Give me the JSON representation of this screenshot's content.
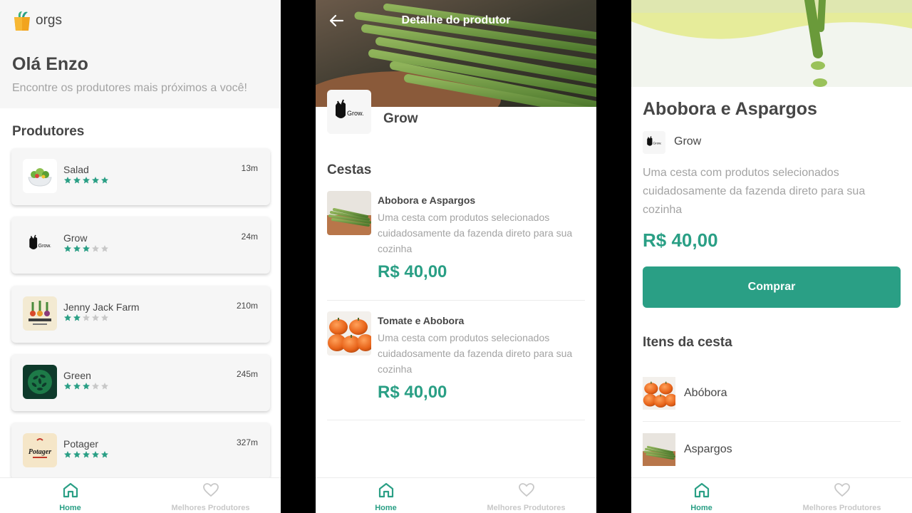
{
  "colors": {
    "accent": "#2a9f85",
    "text": "#464646",
    "muted": "#a3a3a3",
    "star_off": "#c8c8c8"
  },
  "home": {
    "app_name": "orgs",
    "greeting": "Olá Enzo",
    "subtitle": "Encontre os produtores mais próximos a você!",
    "section_title": "Produtores",
    "producers": [
      {
        "name": "Salad",
        "distance": "13m",
        "rating": 5,
        "logo": "salad-bowl-icon"
      },
      {
        "name": "Grow",
        "distance": "24m",
        "rating": 3,
        "logo": "grow-logo"
      },
      {
        "name": "Jenny Jack Farm",
        "distance": "210m",
        "rating": 2,
        "logo": "jenny-jack-logo"
      },
      {
        "name": "Green",
        "distance": "245m",
        "rating": 3,
        "logo": "green-leaves-logo"
      },
      {
        "name": "Potager",
        "distance": "327m",
        "rating": 5,
        "logo": "potager-logo"
      }
    ]
  },
  "nav": {
    "home_label": "Home",
    "favorites_label": "Melhores Produtores"
  },
  "producer_detail": {
    "header_title": "Detalhe do produtor",
    "producer_name": "Grow",
    "logo_text": "Grow.",
    "section_title": "Cestas",
    "baskets": [
      {
        "title": "Abobora e Aspargos",
        "description": "Uma cesta com produtos selecionados cuidadosamente da fazenda direto para sua cozinha",
        "price": "R$ 40,00"
      },
      {
        "title": "Tomate e Abobora",
        "description": "Uma cesta com produtos selecionados cuidadosamente da fazenda direto para sua cozinha",
        "price": "R$ 40,00"
      }
    ]
  },
  "basket_detail": {
    "title": "Abobora e Aspargos",
    "producer_name": "Grow",
    "logo_text": "Grow.",
    "description": "Uma cesta com produtos selecionados cuidadosamente da fazenda direto para sua cozinha",
    "price": "R$ 40,00",
    "buy_label": "Comprar",
    "items_title": "Itens da cesta",
    "items": [
      {
        "name": "Abóbora"
      },
      {
        "name": "Aspargos"
      }
    ]
  }
}
